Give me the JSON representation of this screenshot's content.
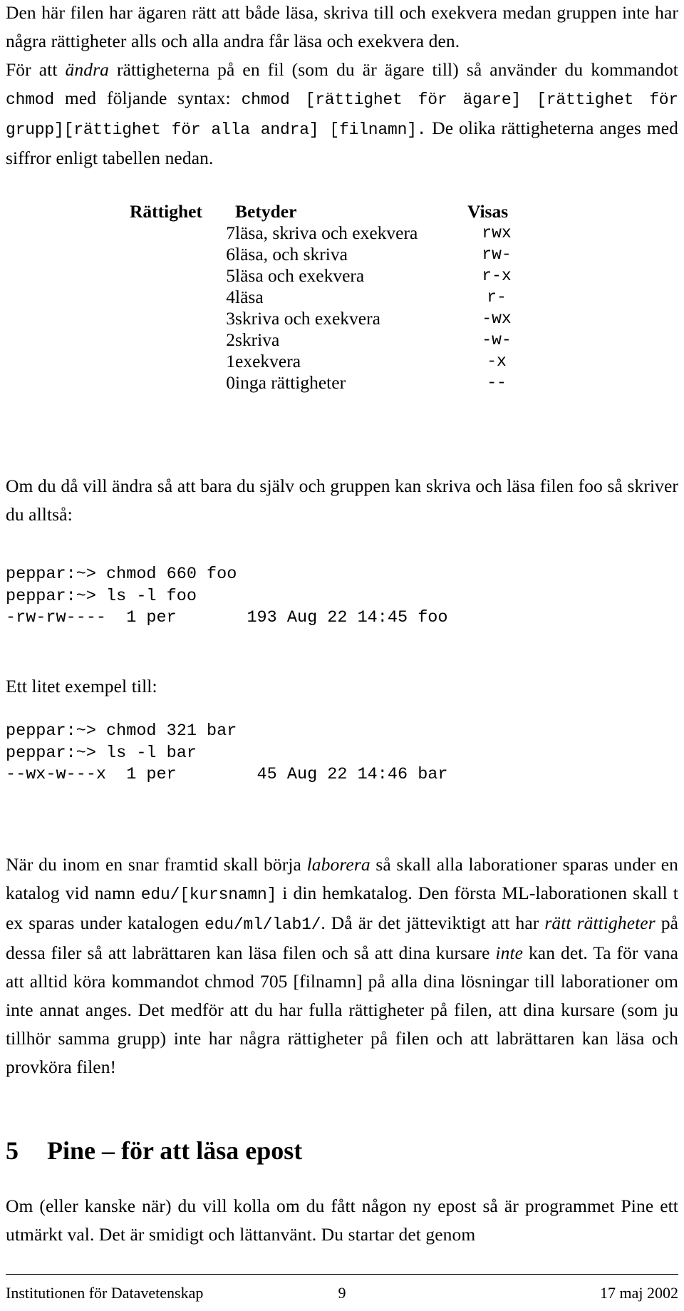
{
  "document": {
    "language": "sv",
    "page_number": "9"
  },
  "paragraphs": {
    "p1_line": "Den här filen har ägaren rätt att både läsa, skriva till och exekvera medan gruppen inte har några rättigheter alls och alla andra får läsa och exekvera den.",
    "p2_a": "För att ",
    "p2_b_italic": "ändra",
    "p2_c": " rättigheterna på en fil (som du är ägare till) så använder du kommandot ",
    "p2_mono1": "chmod",
    "p2_d": " med följande syntax: ",
    "p2_mono2": "chmod [rättighet för ägare] [rättighet för grupp][rättighet för alla andra] [filnamn].",
    "p2_e": " De olika rättigheterna anges med siffror enligt tabellen nedan.",
    "p3": "Om du då vill ändra så att bara du själv och gruppen kan skriva och läsa filen foo så skriver du alltså:",
    "label_ett": "Ett litet exempel till:",
    "p4_a": "När du inom en snar framtid skall börja ",
    "p4_b_italic": "laborera",
    "p4_c": " så skall alla laborationer sparas under en katalog vid namn ",
    "p4_mono1": "edu/[kursnamn]",
    "p4_d": " i din hemkatalog. Den första ML-laborationen skall t ex sparas under katalogen ",
    "p4_mono2": "edu/ml/lab1/",
    "p4_e": ". Då är det jätteviktigt att har ",
    "p4_f_italic": "rätt rättigheter",
    "p4_g": " på dessa filer så att labrättaren kan läsa filen och så att dina kursare ",
    "p4_h_italic": "inte",
    "p4_i": " kan det. Ta för vana att alltid köra kommandot chmod 705 [filnamn] på alla dina lösningar till laborationer om inte annat anges. Det medför att du har fulla rättigheter på filen, att dina kursare (som ju tillhör samma grupp) inte har några rättigheter på filen och att labrättaren kan läsa och provköra filen!",
    "p5": "Om (eller kanske när) du vill kolla om du fått någon ny epost så är programmet Pine ett utmärkt val. Det är smidigt och lättanvänt. Du startar det genom"
  },
  "perm_table": {
    "headers": [
      "Rättighet",
      "Betyder",
      "Visas"
    ],
    "rows": [
      {
        "value": "7",
        "meaning": "läsa, skriva och exekvera",
        "shown": "rwx"
      },
      {
        "value": "6",
        "meaning": "läsa, och skriva",
        "shown": "rw-"
      },
      {
        "value": "5",
        "meaning": "läsa och exekvera",
        "shown": "r-x"
      },
      {
        "value": "4",
        "meaning": "läsa",
        "shown": "r-"
      },
      {
        "value": "3",
        "meaning": "skriva och exekvera",
        "shown": "-wx"
      },
      {
        "value": "2",
        "meaning": "skriva",
        "shown": "-w-"
      },
      {
        "value": "1",
        "meaning": "exekvera",
        "shown": "-x"
      },
      {
        "value": "0",
        "meaning": "inga rättigheter",
        "shown": "--"
      }
    ]
  },
  "terminal_examples": [
    {
      "lines": [
        "peppar:~> chmod 660 foo",
        "peppar:~> ls -l foo",
        "-rw-rw----  1 per       193 Aug 22 14:45 foo"
      ]
    },
    {
      "lines": [
        "peppar:~> chmod 321 bar",
        "peppar:~> ls -l bar",
        "--wx-w---x  1 per        45 Aug 22 14:46 bar"
      ]
    }
  ],
  "section": {
    "number": "5",
    "title": "Pine – för att läsa epost"
  },
  "footer": {
    "left": "Institutionen för Datavetenskap",
    "center": "9",
    "right": "17 maj 2002"
  }
}
